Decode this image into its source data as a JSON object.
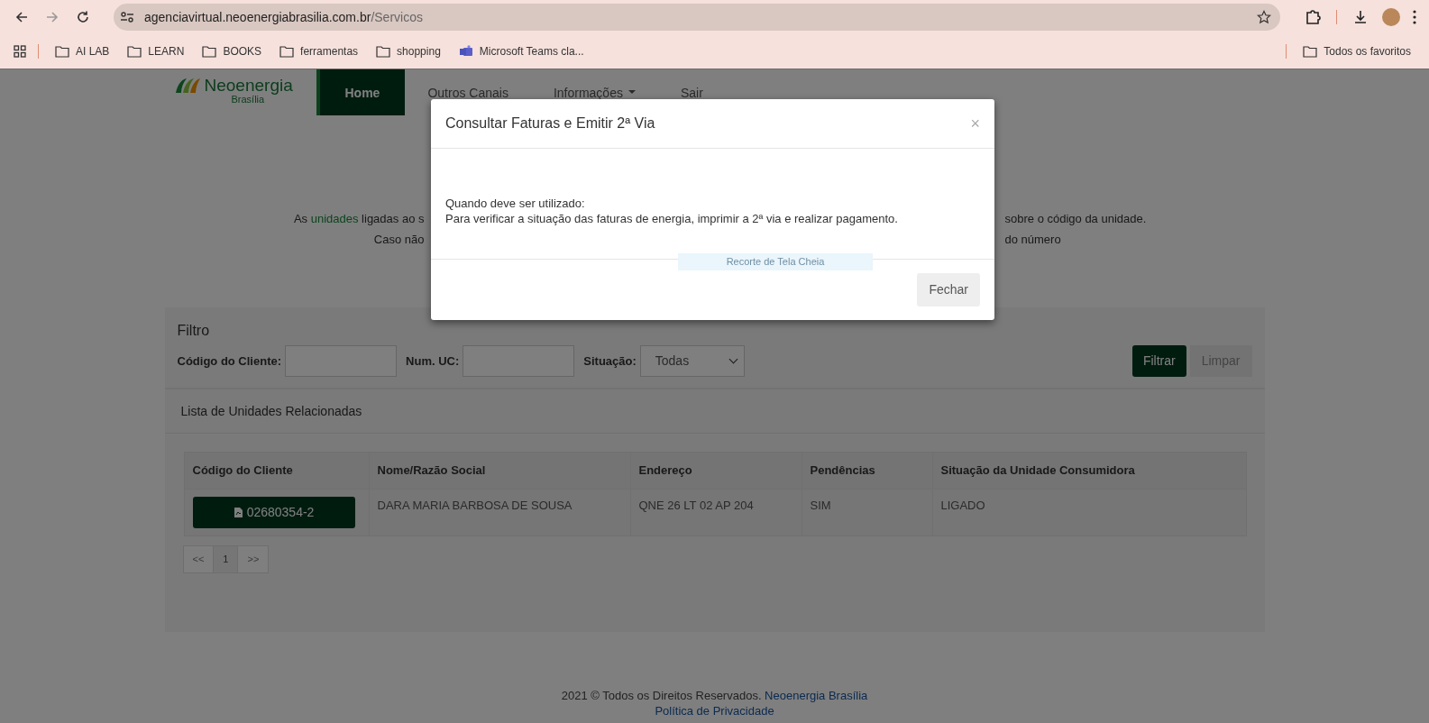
{
  "browser": {
    "url_host": "agenciavirtual.neoenergiabrasilia.com.br",
    "url_path": "/Servicos",
    "bookmarks": [
      {
        "label": "AI LAB",
        "kind": "folder"
      },
      {
        "label": "LEARN",
        "kind": "folder"
      },
      {
        "label": "BOOKS",
        "kind": "folder"
      },
      {
        "label": "ferramentas",
        "kind": "folder"
      },
      {
        "label": "shopping",
        "kind": "folder"
      },
      {
        "label": "Microsoft Teams cla...",
        "kind": "app"
      }
    ],
    "other_bookmarks": "Todos os favoritos"
  },
  "site": {
    "logo": {
      "name": "Neoenergia",
      "sub": "Brasília"
    },
    "nav": [
      {
        "label": "Home",
        "selected": true,
        "dropdown": false
      },
      {
        "label": "Outros Canais",
        "selected": false,
        "dropdown": false
      },
      {
        "label": "Informações",
        "selected": false,
        "dropdown": true
      },
      {
        "label": "Sair",
        "selected": false,
        "dropdown": false
      }
    ],
    "intro": [
      {
        "left": [
          {
            "text": "As ",
            "link": false
          },
          {
            "text": "unidades",
            "link": true
          },
          {
            "text": " ligadas ao s",
            "link": false
          }
        ],
        "right": "sobre o código da unidade."
      },
      {
        "left": [
          {
            "text": "Caso não",
            "link": false
          }
        ],
        "right": "do número"
      }
    ],
    "filter": {
      "title": "Filtro",
      "fields": [
        {
          "label": "Código do Cliente:",
          "kind": "text"
        },
        {
          "label": "Num. UC:",
          "kind": "text"
        },
        {
          "label": "Situação:",
          "kind": "select",
          "value": "Todas"
        }
      ],
      "buttons": [
        {
          "label": "Filtrar",
          "kind": "primary"
        },
        {
          "label": "Limpar",
          "kind": "secondary"
        }
      ]
    },
    "list": {
      "title": "Lista de Unidades Relacionadas",
      "columns": [
        "Código do Cliente",
        "Nome/Razão Social",
        "Endereço",
        "Pendências",
        "Situação da Unidade Consumidora"
      ],
      "rows": [
        {
          "cells": [
            "02680354-2",
            "DARA MARIA BARBOSA DE SOUSA",
            "QNE 26 LT 02 AP 204",
            "SIM",
            "LIGADO"
          ]
        }
      ],
      "pagination": [
        {
          "label": "<<",
          "selected": false
        },
        {
          "label": "1",
          "selected": true
        },
        {
          "label": ">>",
          "selected": false
        }
      ]
    },
    "footer": {
      "text": "2021 © Todos os Direitos Reservados.",
      "link": "Neoenergia Brasília",
      "privacy": "Política de Privacidade"
    }
  },
  "modal": {
    "title": "Consultar Faturas e Emitir 2ª Via",
    "close": "×",
    "body": [
      "Quando deve ser utilizado:",
      "Para verificar a situação das faturas de energia, imprimir a 2ª via e realizar pagamento."
    ],
    "button": "Fechar",
    "capture_label": "Recorte de Tela Cheia"
  }
}
